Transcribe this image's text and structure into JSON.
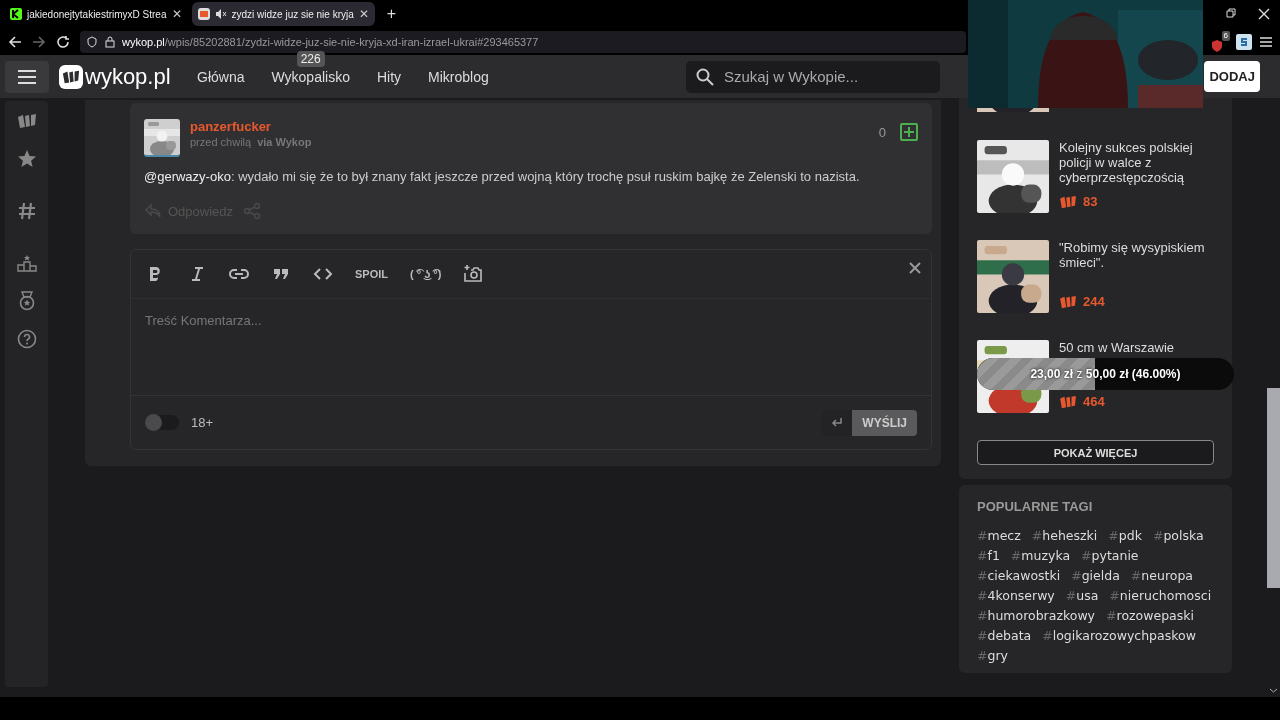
{
  "browser": {
    "tabs": [
      {
        "title": "jakiedonejtytakiestrimyxD Strea",
        "selected": false,
        "muted": false,
        "close": "✕"
      },
      {
        "title": "zydzi widze juz sie nie kryja",
        "selected": true,
        "muted": true,
        "close": "✕"
      }
    ],
    "new_tab": "+",
    "url": {
      "host": "wykop.pl",
      "path": "/wpis/85202881/zydzi-widze-juz-sie-nie-kryja-xd-iran-izrael-ukrai#293465377"
    },
    "extension_badge": "6"
  },
  "header": {
    "logo": "wykop.pl",
    "nav": [
      {
        "label": "Główna"
      },
      {
        "label": "Wykopalisko",
        "badge": "226"
      },
      {
        "label": "Hity"
      },
      {
        "label": "Mikroblog"
      }
    ],
    "search": {
      "placeholder": "Szukaj w Wykopie..."
    },
    "add_button": "DODAJ"
  },
  "comment": {
    "author": "panzerfucker",
    "time": "przed chwilą",
    "via": "via Wykop",
    "mention": "@gerwazy-oko",
    "text": ": wydało mi się że to był znany fakt jeszcze przed wojną który trochę psuł ruskim bajkę że Zelenski to nazista.",
    "votes": "0",
    "reply": "Odpowiedz"
  },
  "editor": {
    "tools": [
      {
        "kind": "bold"
      },
      {
        "kind": "italic"
      },
      {
        "kind": "link"
      },
      {
        "kind": "quote"
      },
      {
        "kind": "code"
      },
      {
        "kind": "text",
        "label": "SPOIL"
      },
      {
        "kind": "text",
        "label": "( ͡° ͜ʖ ͡°)"
      },
      {
        "kind": "camera"
      }
    ],
    "placeholder": "Treść Komentarza...",
    "adult_toggle": {
      "label": "18+",
      "on": false
    },
    "send": "WYŚLIJ"
  },
  "related": {
    "items": [
      {
        "title": "Kolejny sukces polskiej policji w walce z cyberprzestępczością",
        "count": "83"
      },
      {
        "title": "\"Robimy się wysypiskiem śmieci\".",
        "count": "244"
      },
      {
        "title": "50 cm w Warszawie",
        "count": "464"
      }
    ],
    "more": "POKAŻ WIĘCEJ"
  },
  "tags": {
    "title": "POPULARNE TAGI",
    "items": [
      "#mecz",
      "#heheszki",
      "#pdk",
      "#polska",
      "#f1",
      "#muzyka",
      "#pytanie",
      "#ciekawostki",
      "#gielda",
      "#neuropa",
      "#4konserwy",
      "#usa",
      "#nieruchomosci",
      "#humorobrazkowy",
      "#rozowepaski",
      "#debata",
      "#logikarozowychpaskow",
      "#gry"
    ]
  },
  "donation": {
    "text": "**23,00 zł** z **50,00 zł (46.00%)**",
    "level": 0.46
  }
}
